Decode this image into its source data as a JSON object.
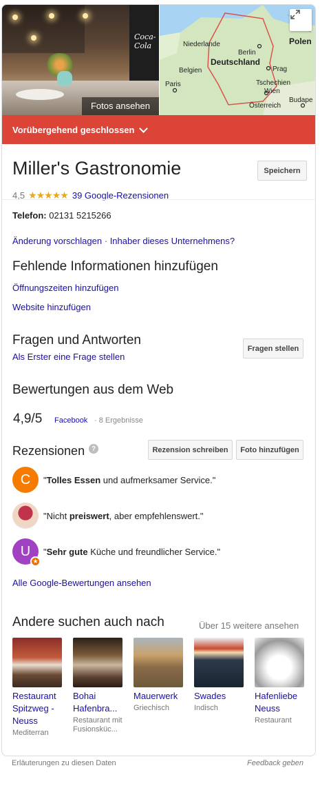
{
  "header": {
    "photos_button": "Fotos ansehen",
    "brand_sign": "Coca-Cola",
    "map_labels": {
      "niederlande": "Niederlande",
      "polen": "Polen",
      "berlin": "Berlin",
      "deutschland": "Deutschland",
      "belgien": "Belgien",
      "prag": "Prag",
      "paris": "Paris",
      "tschechien": "Tschechien",
      "wien": "Wien",
      "oesterreich": "Österreich",
      "budapest": "Budape"
    }
  },
  "status_banner": {
    "label": "Vorübergehend geschlossen",
    "color": "#db4437"
  },
  "business": {
    "name": "Miller's Gastronomie",
    "save_label": "Speichern",
    "rating": "4,5",
    "stars": "★★★★★",
    "reviews_link": "39 Google-Rezensionen",
    "phone_label": "Telefon:",
    "phone_value": "02131 5215266",
    "suggest_edit": "Änderung vorschlagen",
    "separator": "·",
    "owner_link": "Inhaber dieses Unternehmens?"
  },
  "missing_info": {
    "heading": "Fehlende Informationen hinzufügen",
    "add_hours": "Öffnungszeiten hinzufügen",
    "add_website": "Website hinzufügen"
  },
  "qa": {
    "heading": "Fragen und Antworten",
    "first_question": "Als Erster eine Frage stellen",
    "ask_button": "Fragen stellen"
  },
  "web_reviews": {
    "heading": "Bewertungen aus dem Web",
    "score": "4,9/5",
    "source": "Facebook",
    "count": "· 8 Ergebnisse"
  },
  "reviews": {
    "heading": "Rezensionen",
    "help_icon": "?",
    "write_button": "Rezension schreiben",
    "photo_button": "Foto hinzufügen",
    "items": [
      {
        "initial": "C",
        "color": "#f57c00",
        "quote_open": "\"",
        "bold": "Tolles Essen",
        "rest": " und aufmerksamer Service.\"",
        "prefix": ""
      },
      {
        "initial": "",
        "color": "#e8c4b0",
        "quote_open": "\"Nicht ",
        "bold": "preiswert",
        "rest": ", aber empfehlenswert.\"",
        "prefix": ""
      },
      {
        "initial": "U",
        "color": "#a142c2",
        "quote_open": "\"",
        "bold": "Sehr gute",
        "rest": " Küche und freundlicher Service.\"",
        "prefix": ""
      }
    ],
    "all_link": "Alle Google-Bewertungen ansehen"
  },
  "also_searched": {
    "heading": "Andere suchen auch nach",
    "more": "Über 15 weitere ansehen",
    "tiles": [
      {
        "name": "Restaurant Spitzweg - Neuss",
        "sub": "Mediterran"
      },
      {
        "name": "Bohai Hafenbra...",
        "sub": "Restaurant mit Fusionsküc..."
      },
      {
        "name": "Mauerwerk",
        "sub": "Griechisch"
      },
      {
        "name": "Swades",
        "sub": "Indisch"
      },
      {
        "name": "Hafenliebe Neuss",
        "sub": "Restaurant"
      }
    ]
  },
  "footer": {
    "explanations": "Erläuterungen zu diesen Daten",
    "feedback": "Feedback geben"
  }
}
